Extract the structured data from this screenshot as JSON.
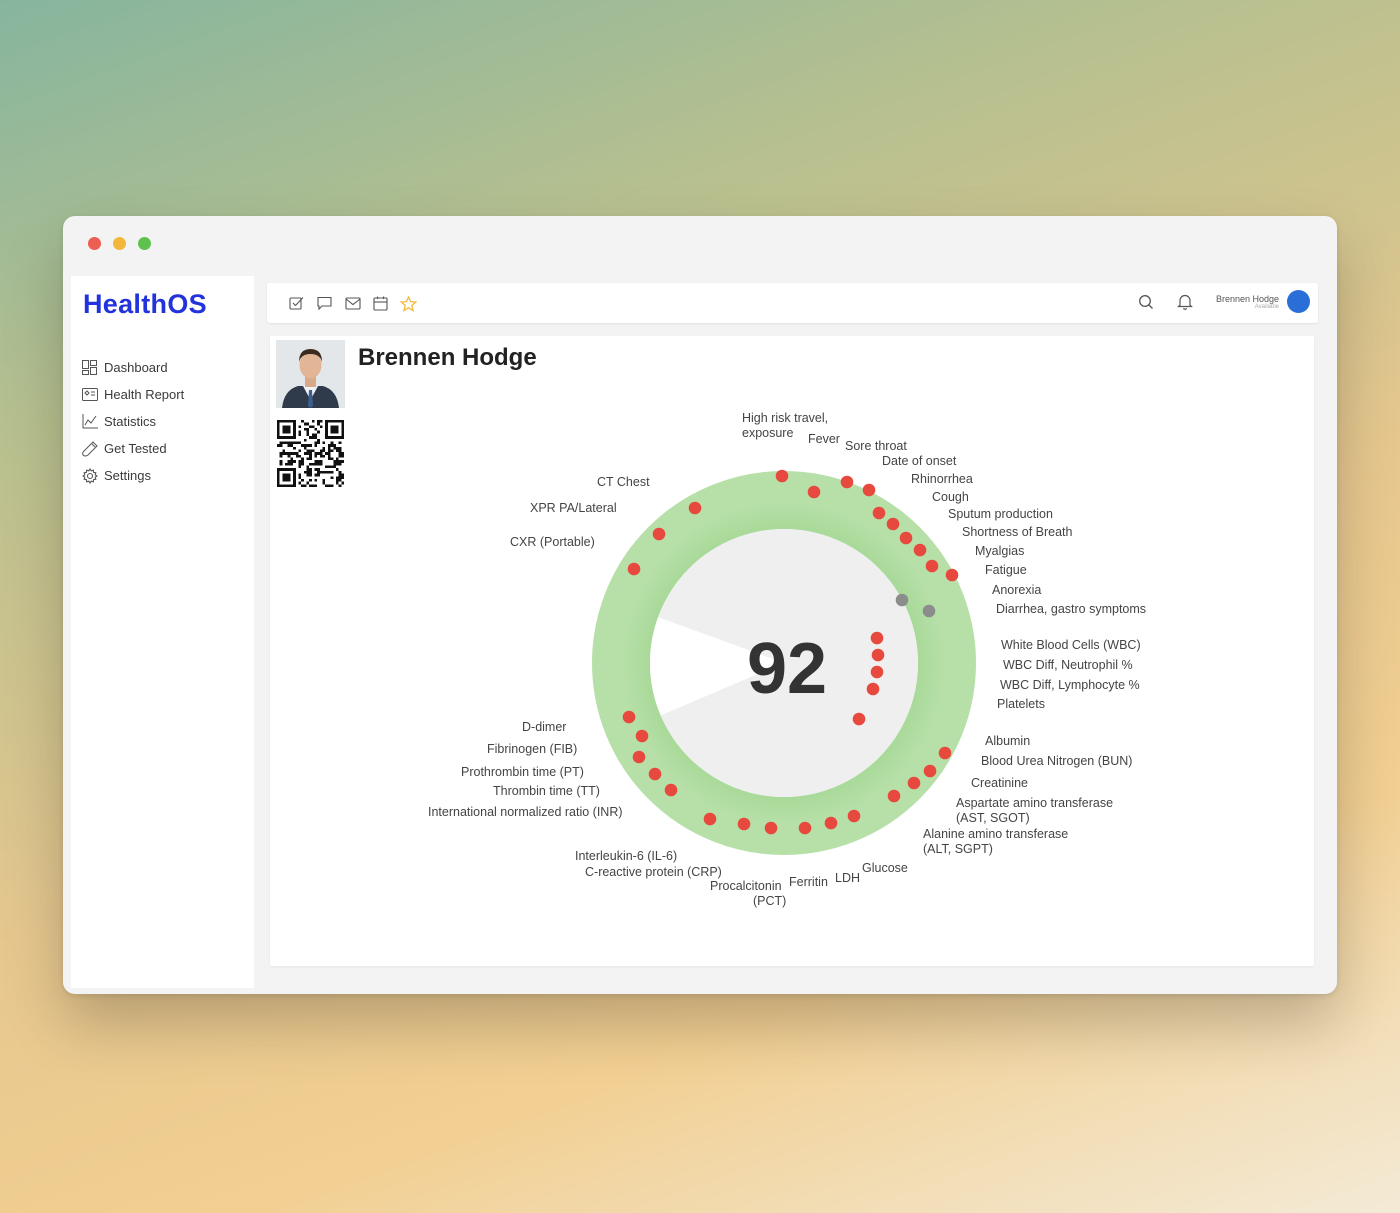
{
  "app": {
    "brand": "HealthOS"
  },
  "sidebar": {
    "items": [
      {
        "label": "Dashboard",
        "icon": "dashboard-icon"
      },
      {
        "label": "Health Report",
        "icon": "health-report-icon"
      },
      {
        "label": "Statistics",
        "icon": "statistics-icon"
      },
      {
        "label": "Get Tested",
        "icon": "test-tube-icon"
      },
      {
        "label": "Settings",
        "icon": "gear-icon"
      }
    ]
  },
  "topbar": {
    "icons": [
      "checkbox-icon",
      "chat-icon",
      "mail-icon",
      "calendar-icon",
      "star-icon"
    ],
    "right_icons": [
      "search-icon",
      "bell-icon"
    ],
    "user": {
      "name": "Brennen Hodge",
      "status": "Available"
    }
  },
  "patient": {
    "name": "Brennen Hodge"
  },
  "colors": {
    "brand": "#2233dd",
    "dot_red": "#e8493e",
    "dot_gray": "#8c8c8c",
    "ring_green": "#a8d89a",
    "star": "#f2b83c"
  },
  "chart_data": {
    "type": "radial-dot",
    "score": "92",
    "labels": [
      "High risk travel,",
      "exposure",
      "Fever",
      "Sore throat",
      "Date of onset",
      "Rhinorrhea",
      "Cough",
      "Sputum production",
      "Shortness of Breath",
      "Myalgias",
      "Fatigue",
      "Anorexia",
      "Diarrhea, gastro symptoms",
      "White Blood Cells (WBC)",
      "WBC Diff, Neutrophil %",
      "WBC Diff, Lymphocyte %",
      "Platelets",
      "Albumin",
      "Blood Urea Nitrogen (BUN)",
      "Creatinine",
      "Aspartate amino transferase",
      "(AST, SGOT)",
      "Alanine amino transferase",
      "(ALT, SGPT)",
      "Glucose",
      "LDH",
      "Ferritin",
      "Procalcitonin",
      "(PCT)",
      "C-reactive protein (CRP)",
      "Interleukin-6 (IL-6)",
      "International normalized ratio (INR)",
      "Thrombin time (TT)",
      "Prothrombin time (PT)",
      "Fibrinogen (FIB)",
      "D-dimer",
      "CXR (Portable)",
      "XPR PA/Lateral",
      "CT Chest"
    ]
  }
}
